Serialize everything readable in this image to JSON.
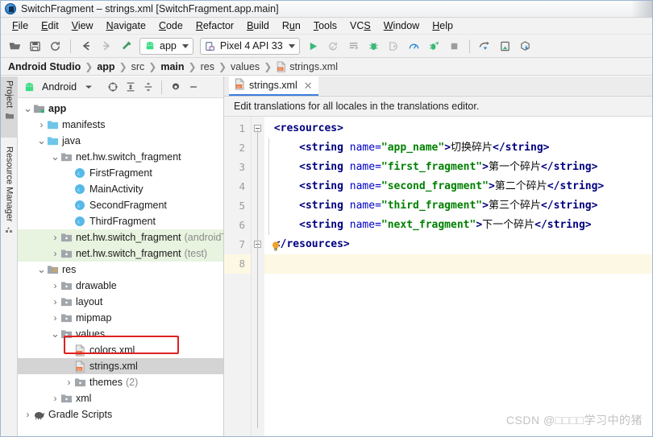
{
  "window": {
    "title": "SwitchFragment – strings.xml [SwitchFragment.app.main]",
    "app_icon": "android-studio-icon"
  },
  "menubar": {
    "items": [
      {
        "label": "File",
        "mnemonic": "F"
      },
      {
        "label": "Edit",
        "mnemonic": "E"
      },
      {
        "label": "View",
        "mnemonic": "V"
      },
      {
        "label": "Navigate",
        "mnemonic": "N"
      },
      {
        "label": "Code",
        "mnemonic": "C"
      },
      {
        "label": "Refactor",
        "mnemonic": "R"
      },
      {
        "label": "Build",
        "mnemonic": "B"
      },
      {
        "label": "Run",
        "mnemonic": "u"
      },
      {
        "label": "Tools",
        "mnemonic": "T"
      },
      {
        "label": "VCS",
        "mnemonic": "S"
      },
      {
        "label": "Window",
        "mnemonic": "W"
      },
      {
        "label": "Help",
        "mnemonic": "H"
      }
    ]
  },
  "toolbar": {
    "icons_left": [
      "open-folder-icon",
      "save-icon",
      "sync-icon"
    ],
    "nav_icons": [
      "back-arrow-icon",
      "forward-arrow-icon",
      "build-hammer-icon"
    ],
    "module_selector": {
      "label": "app",
      "icon": "android-robot-icon"
    },
    "device_selector": {
      "label": "Pixel 4 API 33",
      "icon": "device-icon"
    },
    "icons_right": [
      "run-icon",
      "apply-changes-icon",
      "apply-code-changes-icon",
      "debug-icon",
      "attach-debugger-icon",
      "profiler-icon",
      "run-coverage-icon",
      "stop-icon",
      "sdk-manager-icon",
      "avd-manager-icon",
      "gradle-sync-icon"
    ]
  },
  "breadcrumb": {
    "items": [
      {
        "label": "Android Studio",
        "bold": true
      },
      {
        "label": "app",
        "bold": true
      },
      {
        "label": "src",
        "bold": false
      },
      {
        "label": "main",
        "bold": true
      },
      {
        "label": "res",
        "bold": false
      },
      {
        "label": "values",
        "bold": false
      },
      {
        "label": "strings.xml",
        "bold": false,
        "icon": "xml-file-icon"
      }
    ],
    "separator": "❯"
  },
  "left_strip": {
    "tabs": [
      {
        "label": "Project",
        "icon": "project-icon",
        "active": true
      },
      {
        "label": "Resource Manager",
        "icon": "resource-manager-icon",
        "active": false
      }
    ]
  },
  "project_panel": {
    "header": {
      "title": "Android",
      "icon": "android-robot-icon",
      "caret": "▾",
      "buttons": [
        "select-opened-file-icon",
        "expand-all-icon",
        "collapse-all-icon",
        "settings-gear-icon",
        "hide-panel-icon"
      ]
    },
    "tree": [
      {
        "depth": 0,
        "arrow": "▾",
        "icon": "module-folder-icon",
        "label": "app",
        "bold": true,
        "sub": "",
        "state": "normal"
      },
      {
        "depth": 1,
        "arrow": "›",
        "icon": "folder-blue-icon",
        "label": "manifests",
        "bold": false,
        "sub": "",
        "state": "normal"
      },
      {
        "depth": 1,
        "arrow": "▾",
        "icon": "folder-blue-icon",
        "label": "java",
        "bold": false,
        "sub": "",
        "state": "normal"
      },
      {
        "depth": 2,
        "arrow": "▾",
        "icon": "package-icon",
        "label": "net.hw.switch_fragment",
        "bold": false,
        "sub": "",
        "state": "normal"
      },
      {
        "depth": 3,
        "arrow": "",
        "icon": "java-class-icon",
        "label": "FirstFragment",
        "bold": false,
        "sub": "",
        "state": "normal"
      },
      {
        "depth": 3,
        "arrow": "",
        "icon": "java-class-icon",
        "label": "MainActivity",
        "bold": false,
        "sub": "",
        "state": "normal"
      },
      {
        "depth": 3,
        "arrow": "",
        "icon": "java-class-icon",
        "label": "SecondFragment",
        "bold": false,
        "sub": "",
        "state": "normal"
      },
      {
        "depth": 3,
        "arrow": "",
        "icon": "java-class-icon",
        "label": "ThirdFragment",
        "bold": false,
        "sub": "",
        "state": "normal"
      },
      {
        "depth": 2,
        "arrow": "›",
        "icon": "package-icon",
        "label": "net.hw.switch_fragment",
        "bold": false,
        "sub": "(androidTest)",
        "state": "green"
      },
      {
        "depth": 2,
        "arrow": "›",
        "icon": "package-icon",
        "label": "net.hw.switch_fragment",
        "bold": false,
        "sub": "(test)",
        "state": "green"
      },
      {
        "depth": 1,
        "arrow": "▾",
        "icon": "res-folder-icon",
        "label": "res",
        "bold": false,
        "sub": "",
        "state": "normal"
      },
      {
        "depth": 2,
        "arrow": "›",
        "icon": "package-icon",
        "label": "drawable",
        "bold": false,
        "sub": "",
        "state": "normal"
      },
      {
        "depth": 2,
        "arrow": "›",
        "icon": "package-icon",
        "label": "layout",
        "bold": false,
        "sub": "",
        "state": "normal"
      },
      {
        "depth": 2,
        "arrow": "›",
        "icon": "package-icon",
        "label": "mipmap",
        "bold": false,
        "sub": "",
        "state": "normal"
      },
      {
        "depth": 2,
        "arrow": "▾",
        "icon": "package-icon",
        "label": "values",
        "bold": false,
        "sub": "",
        "state": "normal"
      },
      {
        "depth": 3,
        "arrow": "",
        "icon": "xml-file-icon",
        "label": "colors.xml",
        "bold": false,
        "sub": "",
        "state": "normal"
      },
      {
        "depth": 3,
        "arrow": "",
        "icon": "xml-file-icon",
        "label": "strings.xml",
        "bold": false,
        "sub": "",
        "state": "selected"
      },
      {
        "depth": 3,
        "arrow": "›",
        "icon": "package-icon",
        "label": "themes",
        "bold": false,
        "sub": "(2)",
        "state": "normal"
      },
      {
        "depth": 2,
        "arrow": "›",
        "icon": "package-icon",
        "label": "xml",
        "bold": false,
        "sub": "",
        "state": "normal"
      },
      {
        "depth": 0,
        "arrow": "›",
        "icon": "gradle-elephant-icon",
        "label": "Gradle Scripts",
        "bold": false,
        "sub": "",
        "state": "normal"
      }
    ]
  },
  "editor": {
    "tab": {
      "label": "strings.xml",
      "icon": "xml-file-icon",
      "close": "✕",
      "active": true
    },
    "notification": "Edit translations for all locales in the translations editor.",
    "line_numbers": [
      "1",
      "2",
      "3",
      "4",
      "5",
      "6",
      "7",
      "8"
    ],
    "current_line": 8,
    "lightbulb_icon": "intention-bulb-icon",
    "code": [
      {
        "n": 1,
        "indent": 0,
        "tokens": [
          {
            "t": "tag",
            "s": "<resources>"
          }
        ]
      },
      {
        "n": 2,
        "indent": 1,
        "tokens": [
          {
            "t": "tag",
            "s": "<string "
          },
          {
            "t": "attr",
            "s": "name="
          },
          {
            "t": "val",
            "s": "\"app_name\""
          },
          {
            "t": "tag",
            "s": ">"
          },
          {
            "t": "txt",
            "s": "切换碎片"
          },
          {
            "t": "tag",
            "s": "</string>"
          }
        ]
      },
      {
        "n": 3,
        "indent": 1,
        "tokens": [
          {
            "t": "tag",
            "s": "<string "
          },
          {
            "t": "attr",
            "s": "name="
          },
          {
            "t": "val",
            "s": "\"first_fragment\""
          },
          {
            "t": "tag",
            "s": ">"
          },
          {
            "t": "txt",
            "s": "第一个碎片"
          },
          {
            "t": "tag",
            "s": "</string>"
          }
        ]
      },
      {
        "n": 4,
        "indent": 1,
        "tokens": [
          {
            "t": "tag",
            "s": "<string "
          },
          {
            "t": "attr",
            "s": "name="
          },
          {
            "t": "val",
            "s": "\"second_fragment\""
          },
          {
            "t": "tag",
            "s": ">"
          },
          {
            "t": "txt",
            "s": "第二个碎片"
          },
          {
            "t": "tag",
            "s": "</string>"
          }
        ]
      },
      {
        "n": 5,
        "indent": 1,
        "tokens": [
          {
            "t": "tag",
            "s": "<string "
          },
          {
            "t": "attr",
            "s": "name="
          },
          {
            "t": "val",
            "s": "\"third_fragment\""
          },
          {
            "t": "tag",
            "s": ">"
          },
          {
            "t": "txt",
            "s": "第三个碎片"
          },
          {
            "t": "tag",
            "s": "</string>"
          }
        ]
      },
      {
        "n": 6,
        "indent": 1,
        "tokens": [
          {
            "t": "tag",
            "s": "<string "
          },
          {
            "t": "attr",
            "s": "name="
          },
          {
            "t": "val",
            "s": "\"next_fragment\""
          },
          {
            "t": "tag",
            "s": ">"
          },
          {
            "t": "txt",
            "s": "下一个碎片"
          },
          {
            "t": "tag",
            "s": "</string>"
          }
        ]
      },
      {
        "n": 7,
        "indent": 0,
        "tokens": [
          {
            "t": "tag",
            "s": "</resources>"
          }
        ]
      },
      {
        "n": 8,
        "indent": 0,
        "tokens": []
      }
    ]
  },
  "watermark": "CSDN @□□□□学习中的猪",
  "colors": {
    "accent_blue": "#3b7ddd",
    "android_green": "#3ddc84",
    "annotation_red": "#e02020",
    "tag": "#000080",
    "attr": "#0000c8",
    "value": "#008000",
    "selection_gray": "#d4d4d4",
    "test_green": "#e8f3e0",
    "current_line": "#fdf8e3"
  }
}
